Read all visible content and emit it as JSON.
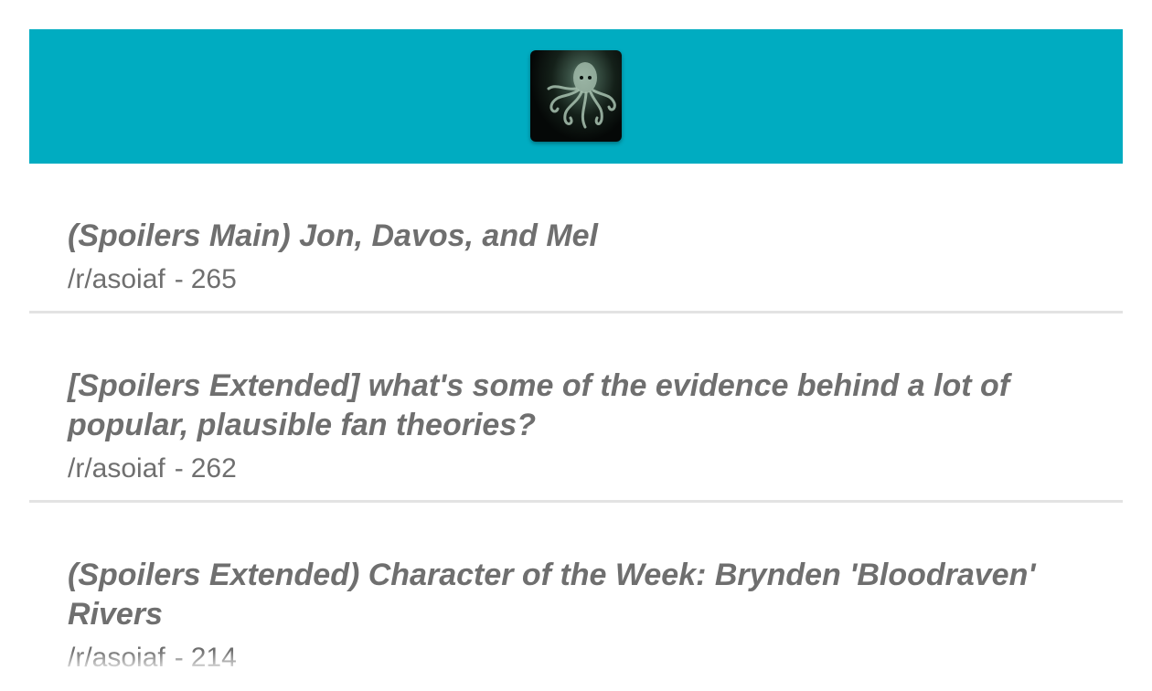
{
  "header": {
    "background_color": "#00acc1",
    "avatar_icon": "octopus-icon"
  },
  "posts": [
    {
      "title": "(Spoilers Main) Jon, Davos, and Mel",
      "subreddit": "/r/asoiaf",
      "separator": "-",
      "score": "265"
    },
    {
      "title": "[Spoilers Extended] what's some of the evidence behind a lot of popular, plausible fan theories?",
      "subreddit": "/r/asoiaf",
      "separator": "-",
      "score": "262"
    },
    {
      "title": "(Spoilers Extended) Character of the Week: Brynden 'Bloodraven' Rivers",
      "subreddit": "/r/asoiaf",
      "separator": "-",
      "score": "214"
    }
  ]
}
